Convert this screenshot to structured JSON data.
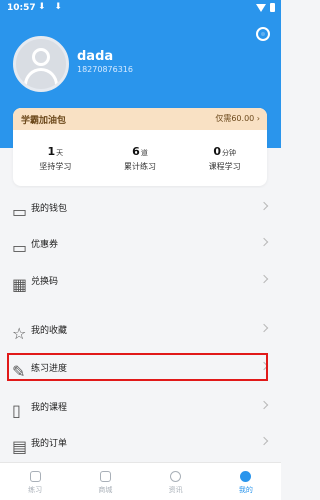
{
  "status_bar": {
    "time": "10:57",
    "left_icons": "⬇ ⬇"
  },
  "header": {
    "user_name": "dada",
    "phone": "18270876316",
    "settings_icon": "settings-icon"
  },
  "wallet": {
    "title": "学霸加油包",
    "price": "仅需60.00"
  },
  "stats": [
    {
      "value": "1",
      "unit": "天",
      "label": "坚持学习"
    },
    {
      "value": "6",
      "unit": "道",
      "label": "累计练习"
    },
    {
      "value": "0",
      "unit": "分钟",
      "label": "课程学习"
    }
  ],
  "menu": [
    {
      "label": "我的钱包",
      "icon": "wallet-icon"
    },
    {
      "label": "优惠券",
      "icon": "coupon-icon"
    },
    {
      "label": "兑换码",
      "icon": "grid-icon"
    },
    {
      "label": "我的收藏",
      "icon": "star-icon"
    },
    {
      "label": "练习进度",
      "icon": "pencil-icon"
    },
    {
      "label": "我的课程",
      "icon": "book-icon"
    },
    {
      "label": "我的订单",
      "icon": "order-icon"
    }
  ],
  "tabs": [
    {
      "label": "练习",
      "icon": "practice-icon",
      "active": false
    },
    {
      "label": "商城",
      "icon": "shop-icon",
      "active": false
    },
    {
      "label": "资讯",
      "icon": "news-icon",
      "active": false
    },
    {
      "label": "我的",
      "icon": "profile-icon",
      "active": true
    }
  ],
  "colors": {
    "accent": "#2a95ec",
    "highlight": "#e11919"
  }
}
